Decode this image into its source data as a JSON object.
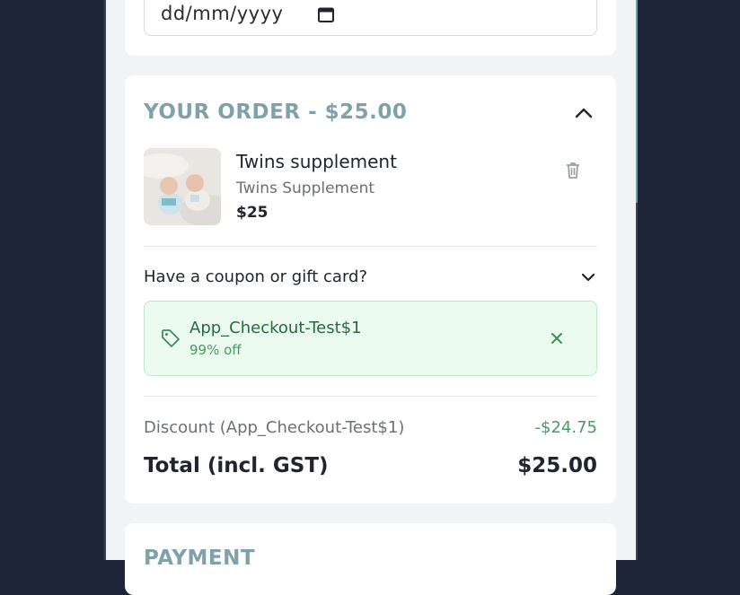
{
  "date_field": {
    "placeholder": "dd/mm/yyyy",
    "icon": "calendar-icon"
  },
  "order": {
    "title": "YOUR ORDER - $25.00",
    "collapse_icon": "chevron-up-icon",
    "item": {
      "name": "Twins supplement",
      "variant": "Twins Supplement",
      "price": "$25",
      "delete_icon": "trash-icon"
    },
    "coupon": {
      "toggle_label": "Have a coupon or gift card?",
      "toggle_icon": "chevron-down-icon",
      "applied_code": "App_Checkout-Test$1",
      "applied_desc": "99% off",
      "tag_icon": "tag-icon",
      "remove_icon": "close-icon"
    },
    "discount": {
      "label": "Discount (App_Checkout-Test$1)",
      "value": "-$24.75"
    },
    "total": {
      "label": "Total (incl. GST)",
      "value": "$25.00"
    }
  },
  "payment": {
    "title": "PAYMENT"
  },
  "colors": {
    "background": "#1e2538",
    "accent_title": "#7fa1aa",
    "success_green": "#4a9a62",
    "coupon_bg": "#ecfbf0"
  }
}
